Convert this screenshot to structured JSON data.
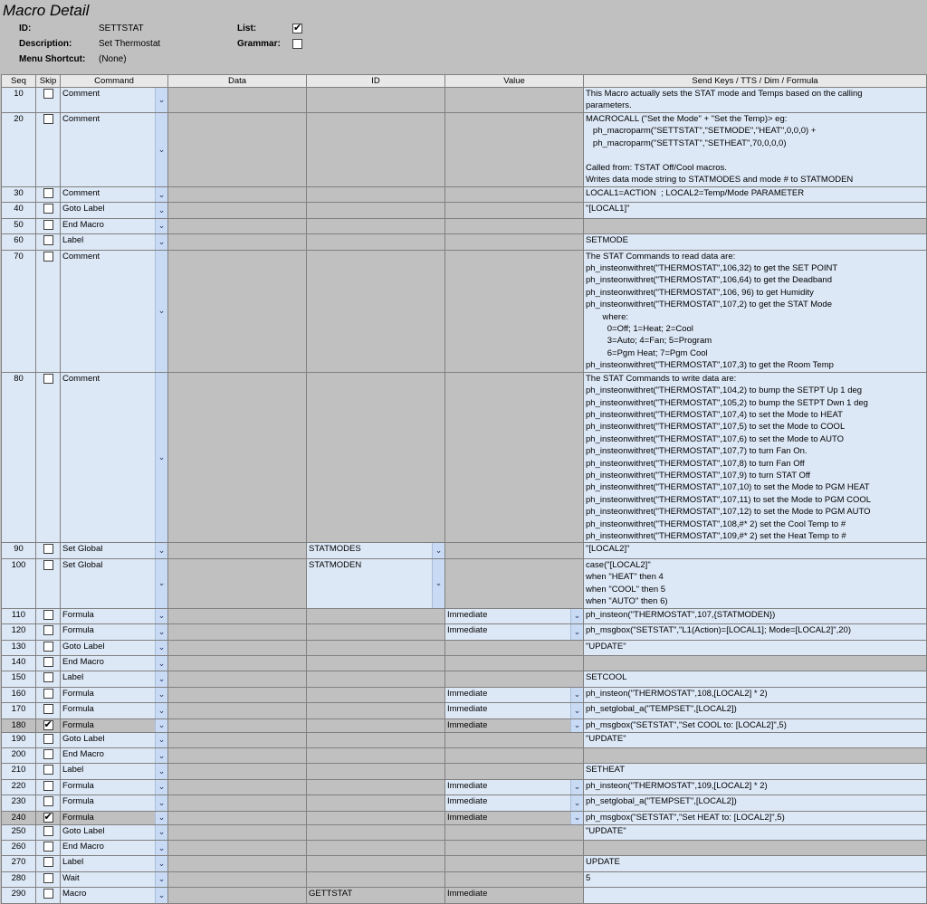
{
  "header": {
    "title": "Macro Detail",
    "id_label": "ID:",
    "id_value": "SETTSTAT",
    "desc_label": "Description:",
    "desc_value": "Set Thermostat",
    "shortcut_label": "Menu Shortcut:",
    "shortcut_value": "(None)",
    "list_label": "List:",
    "list_checked": "✔",
    "grammar_label": "Grammar:",
    "grammar_checked": ""
  },
  "columns": [
    "Seq",
    "Skip",
    "Command",
    "Data",
    "ID",
    "Value",
    "Send Keys / TTS / Dim / Formula"
  ],
  "rows": [
    {
      "seq": "10",
      "skip": "",
      "command": "Comment",
      "id": "",
      "value": "",
      "formula": "This Macro actually sets the STAT mode and Temps based on the calling\nparameters."
    },
    {
      "seq": "20",
      "skip": "",
      "command": "Comment",
      "id": "",
      "value": "",
      "formula": "MACROCALL (\"Set the Mode\" + \"Set the Temp)> eg:\n   ph_macroparm(\"SETTSTAT\",\"SETMODE\",\"HEAT\",0,0,0) +\n   ph_macroparm(\"SETTSTAT\",\"SETHEAT\",70,0,0,0)\n\nCalled from: TSTAT Off/Cool macros.\nWrites data mode string to STATMODES and mode # to STATMODEN"
    },
    {
      "seq": "30",
      "skip": "",
      "command": "Comment",
      "id": "",
      "value": "",
      "formula": "LOCAL1=ACTION  ; LOCAL2=Temp/Mode PARAMETER"
    },
    {
      "seq": "40",
      "skip": "",
      "command": "Goto Label",
      "id": "",
      "value": "",
      "formula": "\"[LOCAL1]\""
    },
    {
      "seq": "50",
      "skip": "",
      "command": "End Macro",
      "id": "",
      "value": "",
      "formula": ""
    },
    {
      "seq": "60",
      "skip": "",
      "command": "Label",
      "id": "",
      "value": "",
      "formula": "SETMODE"
    },
    {
      "seq": "70",
      "skip": "",
      "command": "Comment",
      "id": "",
      "value": "",
      "formula": "The STAT Commands to read data are:\nph_insteonwithret(\"THERMOSTAT\",106,32) to get the SET POINT\nph_insteonwithret(\"THERMOSTAT\",106,64) to get the Deadband\nph_insteonwithret(\"THERMOSTAT\",106, 96) to get Humidity\nph_insteonwithret(\"THERMOSTAT\",107,2) to get the STAT Mode\n       where:\n         0=Off; 1=Heat; 2=Cool\n         3=Auto; 4=Fan; 5=Program\n         6=Pgm Heat; 7=Pgm Cool\nph_insteonwithret(\"THERMOSTAT\",107,3) to get the Room Temp"
    },
    {
      "seq": "80",
      "skip": "",
      "command": "Comment",
      "id": "",
      "value": "",
      "formula": "The STAT Commands to write data are:\nph_insteonwithret(\"THERMOSTAT\",104,2) to bump the SETPT Up 1 deg\nph_insteonwithret(\"THERMOSTAT\",105,2) to bump the SETPT Dwn 1 deg\nph_insteonwithret(\"THERMOSTAT\",107,4) to set the Mode to HEAT\nph_insteonwithret(\"THERMOSTAT\",107,5) to set the Mode to COOL\nph_insteonwithret(\"THERMOSTAT\",107,6) to set the Mode to AUTO\nph_insteonwithret(\"THERMOSTAT\",107,7) to turn Fan On.\nph_insteonwithret(\"THERMOSTAT\",107,8) to turn Fan Off\nph_insteonwithret(\"THERMOSTAT\",107,9) to turn STAT Off\nph_insteonwithret(\"THERMOSTAT\",107,10) to set the Mode to PGM HEAT\nph_insteonwithret(\"THERMOSTAT\",107,11) to set the Mode to PGM COOL\nph_insteonwithret(\"THERMOSTAT\",107,12) to set the Mode to PGM AUTO\nph_insteonwithret(\"THERMOSTAT\",108,#* 2) set the Cool Temp to #\nph_insteonwithret(\"THERMOSTAT\",109,#* 2) set the Heat Temp to #"
    },
    {
      "seq": "90",
      "skip": "",
      "command": "Set Global",
      "id": "STATMODES",
      "value": "",
      "formula": "\"[LOCAL2]\""
    },
    {
      "seq": "100",
      "skip": "",
      "command": "Set Global",
      "id": "STATMODEN",
      "value": "",
      "formula": "case(\"[LOCAL2]\"\nwhen \"HEAT\" then 4\nwhen \"COOL\" then 5\nwhen \"AUTO\" then 6)"
    },
    {
      "seq": "110",
      "skip": "",
      "command": "Formula",
      "id": "",
      "value": "Immediate",
      "formula": "ph_insteon(\"THERMOSTAT\",107,{STATMODEN})"
    },
    {
      "seq": "120",
      "skip": "",
      "command": "Formula",
      "id": "",
      "value": "Immediate",
      "formula": "ph_msgbox(\"SETSTAT\",\"L1(Action)=[LOCAL1]; Mode=[LOCAL2]\",20)"
    },
    {
      "seq": "130",
      "skip": "",
      "command": "Goto Label",
      "id": "",
      "value": "",
      "formula": "\"UPDATE\""
    },
    {
      "seq": "140",
      "skip": "",
      "command": "End Macro",
      "id": "",
      "value": "",
      "formula": ""
    },
    {
      "seq": "150",
      "skip": "",
      "command": "Label",
      "id": "",
      "value": "",
      "formula": "SETCOOL"
    },
    {
      "seq": "160",
      "skip": "",
      "command": "Formula",
      "id": "",
      "value": "Immediate",
      "formula": "ph_insteon(\"THERMOSTAT\",108,[LOCAL2] * 2)"
    },
    {
      "seq": "170",
      "skip": "",
      "command": "Formula",
      "id": "",
      "value": "Immediate",
      "formula": "ph_setglobal_a(\"TEMPSET\",[LOCAL2])"
    },
    {
      "seq": "180",
      "skip": "✔",
      "command": "Formula",
      "id": "",
      "value": "Immediate",
      "formula": "ph_msgbox(\"SETSTAT\",\"Set COOL to: [LOCAL2]\",5)"
    },
    {
      "seq": "190",
      "skip": "",
      "command": "Goto Label",
      "id": "",
      "value": "",
      "formula": "\"UPDATE\""
    },
    {
      "seq": "200",
      "skip": "",
      "command": "End Macro",
      "id": "",
      "value": "",
      "formula": ""
    },
    {
      "seq": "210",
      "skip": "",
      "command": "Label",
      "id": "",
      "value": "",
      "formula": "SETHEAT"
    },
    {
      "seq": "220",
      "skip": "",
      "command": "Formula",
      "id": "",
      "value": "Immediate",
      "formula": "ph_insteon(\"THERMOSTAT\",109,[LOCAL2] * 2)"
    },
    {
      "seq": "230",
      "skip": "",
      "command": "Formula",
      "id": "",
      "value": "Immediate",
      "formula": "ph_setglobal_a(\"TEMPSET\",[LOCAL2])"
    },
    {
      "seq": "240",
      "skip": "✔",
      "command": "Formula",
      "id": "",
      "value": "Immediate",
      "formula": "ph_msgbox(\"SETSTAT\",\"Set HEAT to: [LOCAL2]\",5)"
    },
    {
      "seq": "250",
      "skip": "",
      "command": "Goto Label",
      "id": "",
      "value": "",
      "formula": "\"UPDATE\""
    },
    {
      "seq": "260",
      "skip": "",
      "command": "End Macro",
      "id": "",
      "value": "",
      "formula": ""
    },
    {
      "seq": "270",
      "skip": "",
      "command": "Label",
      "id": "",
      "value": "",
      "formula": "UPDATE"
    },
    {
      "seq": "280",
      "skip": "",
      "command": "Wait",
      "id": "",
      "value": "",
      "formula": "5"
    },
    {
      "seq": "290",
      "skip": "",
      "command": "Macro",
      "id": "GETTSTAT",
      "value": "Immediate",
      "formula": ""
    }
  ],
  "icons": {
    "dropdown": "chevron-down-icon",
    "check": "checkmark-icon"
  },
  "colors": {
    "row_blue": "#dde8f6",
    "row_gray": "#c0c0c0",
    "background": "#c0c0c0"
  }
}
